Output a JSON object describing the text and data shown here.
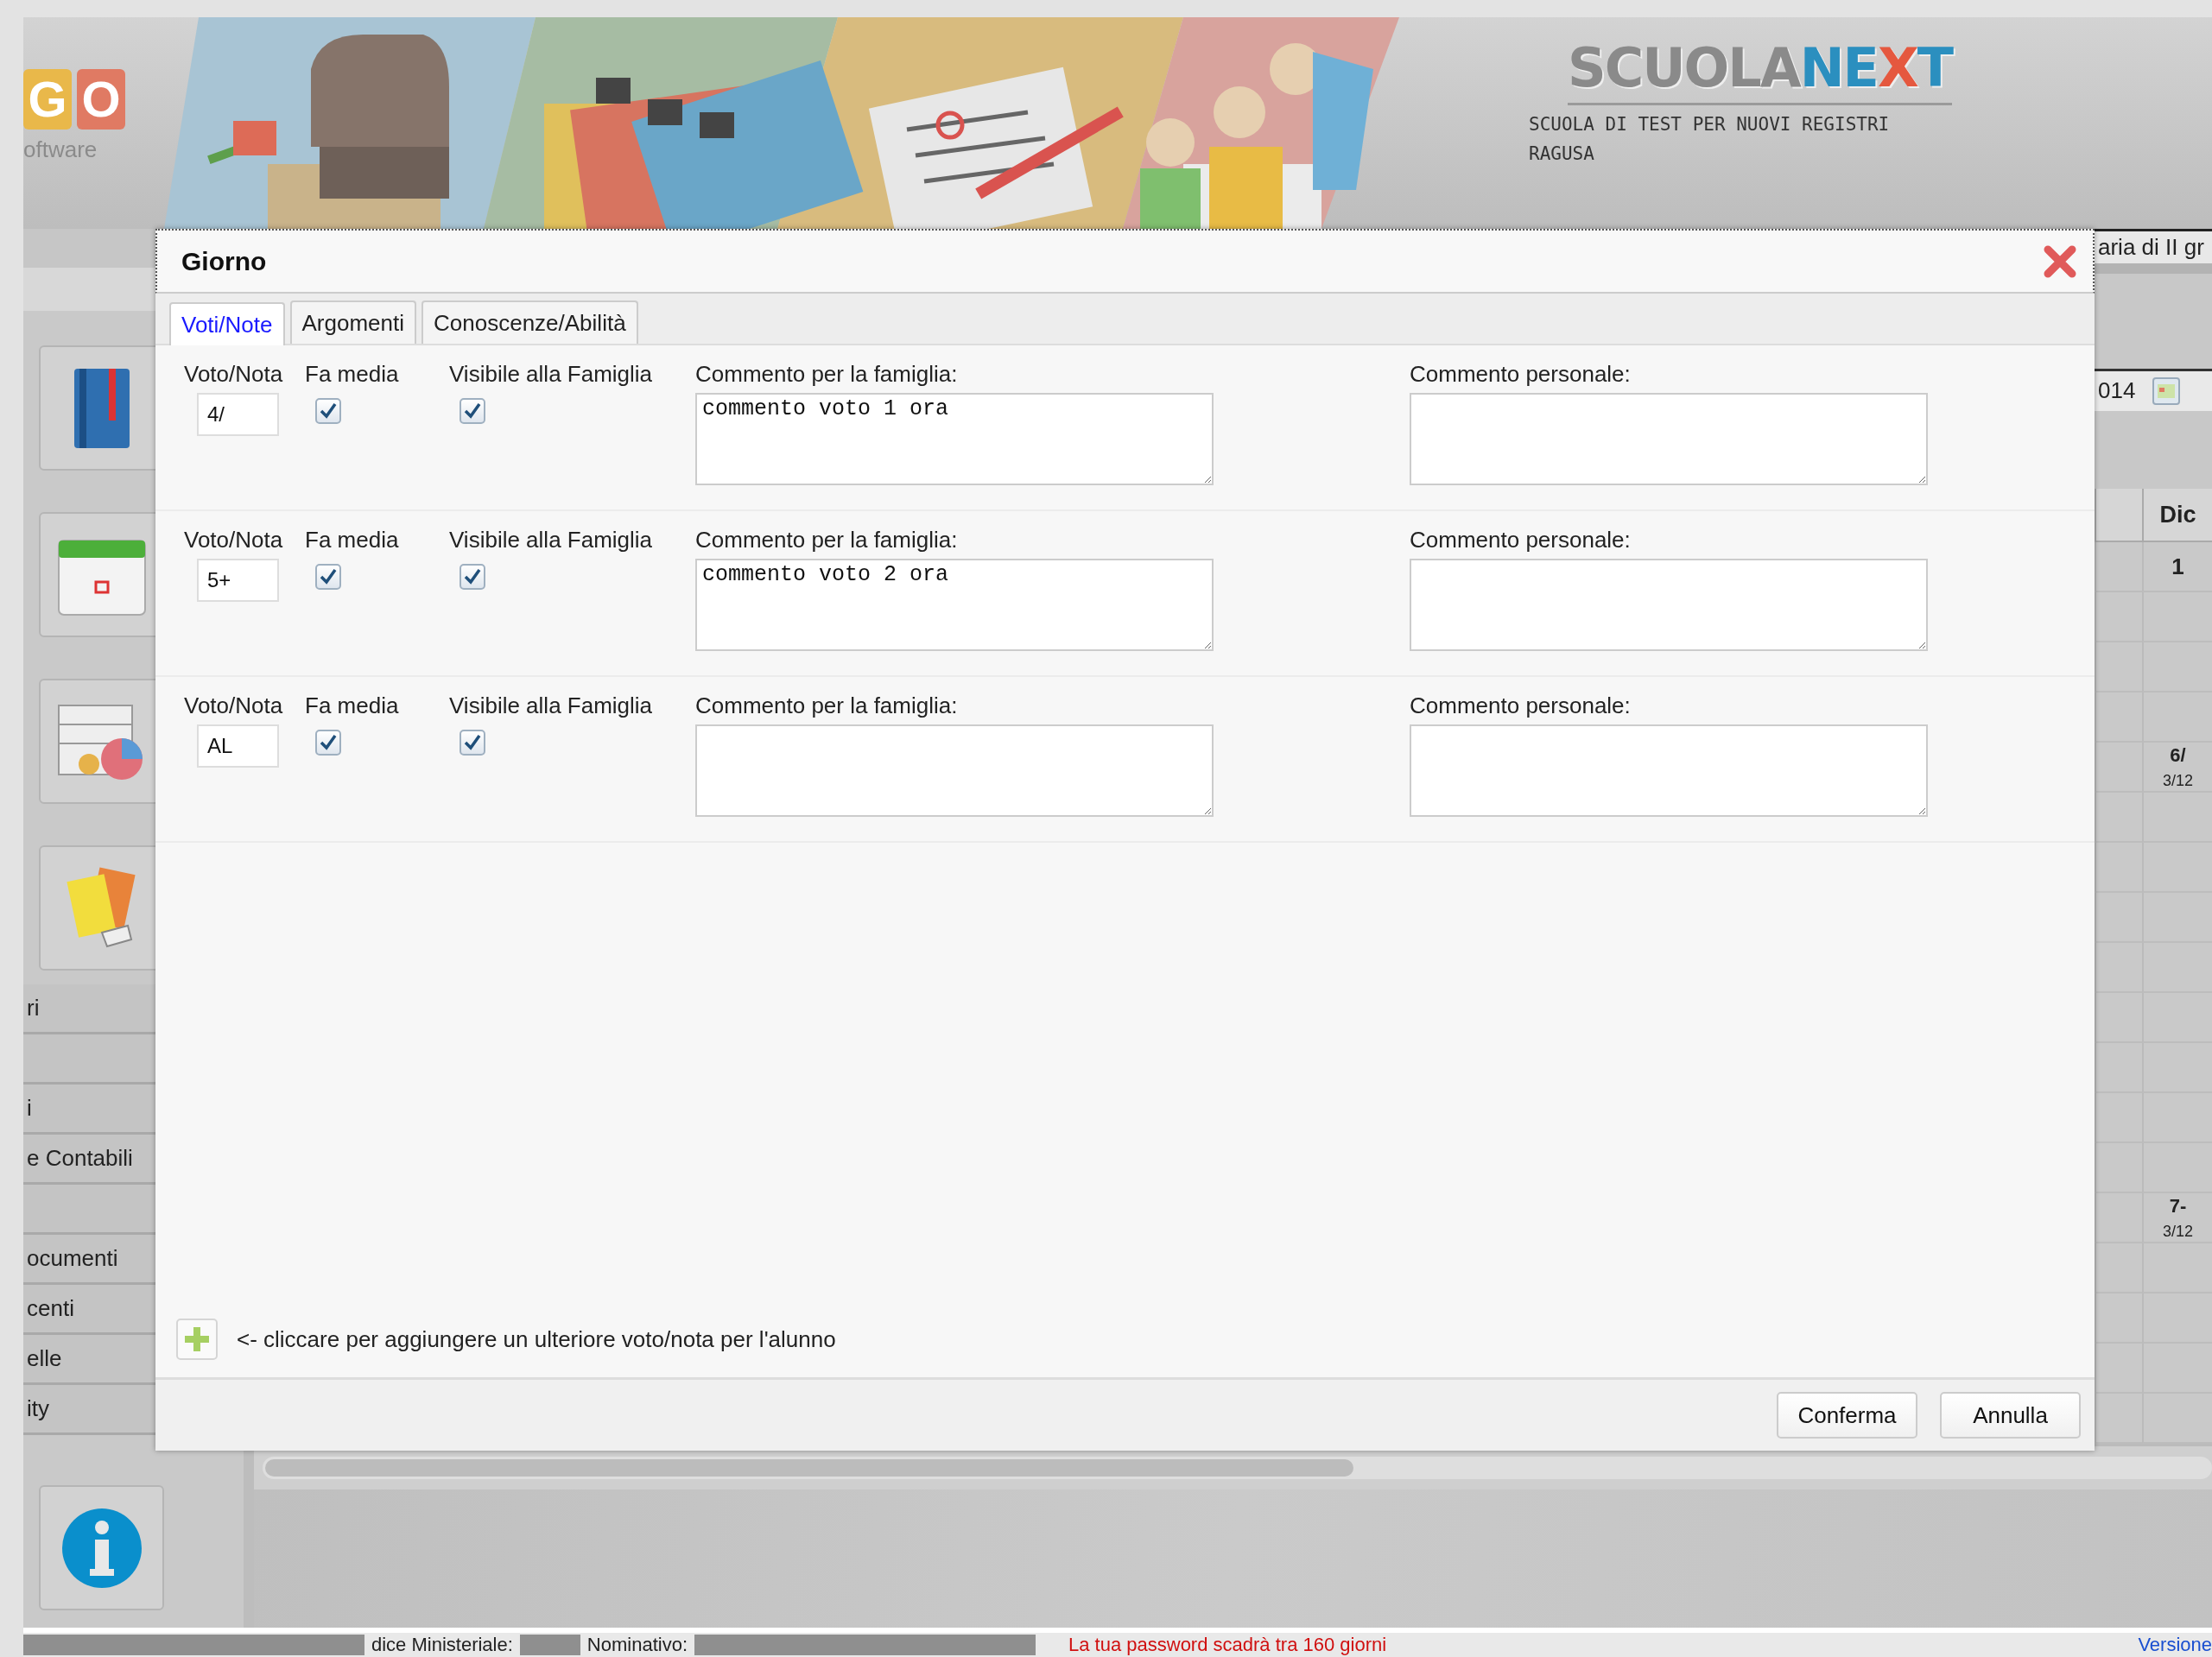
{
  "header": {
    "logo_letters": [
      {
        "text": "G",
        "color": "#e9b84a"
      },
      {
        "text": "O",
        "color": "#e07a63"
      }
    ],
    "logo_caption": "oftware",
    "brand": [
      {
        "text": "SCUOLA",
        "color": "#8a8a8a"
      },
      {
        "text": "NE",
        "color": "#2b8fbf"
      },
      {
        "text": "X",
        "color": "#e5583f"
      },
      {
        "text": "T",
        "color": "#2b8fbf"
      }
    ],
    "school": "SCUOLA DI TEST PER NUOVI REGISTRI",
    "city": "RAGUSA"
  },
  "sidebar": {
    "tiles": [
      {
        "kind": "book"
      },
      {
        "kind": "calendar"
      },
      {
        "kind": "chart"
      },
      {
        "kind": "cards"
      }
    ],
    "items": [
      {
        "kind": "text",
        "label": "ri"
      },
      {
        "kind": "blank"
      },
      {
        "kind": "text",
        "label": "i"
      },
      {
        "kind": "text",
        "label": "e Contabili"
      },
      {
        "kind": "blank"
      },
      {
        "kind": "text",
        "label": "ocumenti"
      },
      {
        "kind": "text",
        "label": "centi"
      },
      {
        "kind": "text",
        "label": "elle"
      },
      {
        "kind": "text",
        "label": "ity"
      }
    ],
    "bottom_tile": {
      "kind": "info"
    }
  },
  "main": {
    "select_text": "aria di II gr",
    "date_value": "014",
    "table": {
      "columns": [
        "Dic"
      ],
      "rows": [
        {
          "kind": "day",
          "text": "1"
        },
        {
          "kind": "blank"
        },
        {
          "kind": "blank"
        },
        {
          "kind": "blank"
        },
        {
          "kind": "grade",
          "value": "6/",
          "date": "3/12"
        },
        {
          "kind": "blank"
        },
        {
          "kind": "blank"
        },
        {
          "kind": "blank"
        },
        {
          "kind": "blank"
        },
        {
          "kind": "blank"
        },
        {
          "kind": "blank"
        },
        {
          "kind": "blank"
        },
        {
          "kind": "blank"
        },
        {
          "kind": "grade",
          "value": "7-",
          "date": "3/12"
        },
        {
          "kind": "blank"
        },
        {
          "kind": "blank"
        },
        {
          "kind": "blank"
        },
        {
          "kind": "blank"
        }
      ]
    }
  },
  "dialog": {
    "title": "Giorno",
    "tabs": [
      {
        "label": "Voti/Note",
        "selected": true
      },
      {
        "label": "Argomenti",
        "selected": false
      },
      {
        "label": "Conoscenze/Abilità",
        "selected": false
      }
    ],
    "entries": [
      {
        "grade_label": "Voto/Nota",
        "grade": "4/",
        "average_label": "Fa media",
        "average": true,
        "visible_label": "Visibile alla Famiglia",
        "visible": true,
        "family_comment_label": "Commento per la famiglia:",
        "family_comment": "commento voto 1 ora",
        "personal_comment_label": "Commento personale:"
      },
      {
        "grade_label": "Voto/Nota",
        "grade": "5+",
        "average_label": "Fa media",
        "average": true,
        "visible_label": "Visibile alla Famiglia",
        "visible": true,
        "family_comment_label": "Commento per la famiglia:",
        "family_comment": "commento voto 2 ora",
        "personal_comment_label": "Commento personale:"
      },
      {
        "grade_label": "Voto/Nota",
        "grade": "AL",
        "average_label": "Fa media",
        "average": true,
        "visible_label": "Visibile alla Famiglia",
        "visible": true,
        "family_comment_label": "Commento per la famiglia:",
        "personal_comment_label": "Commento personale:"
      }
    ],
    "add_hint": "<- cliccare per aggiungere un ulteriore voto/nota per l'alunno",
    "buttons": [
      "Conferma",
      "Annulla"
    ]
  },
  "status_bar": {
    "items": [
      {
        "kind": "redacted"
      },
      {
        "kind": "text",
        "text": "dice Ministeriale:"
      },
      {
        "kind": "stub"
      },
      {
        "kind": "text",
        "text": "Nominativo:"
      },
      {
        "kind": "redacted"
      },
      {
        "kind": "alert",
        "text": "La tua password scadrà tra 160 giorni"
      },
      {
        "kind": "link",
        "text": "Versione"
      }
    ]
  }
}
